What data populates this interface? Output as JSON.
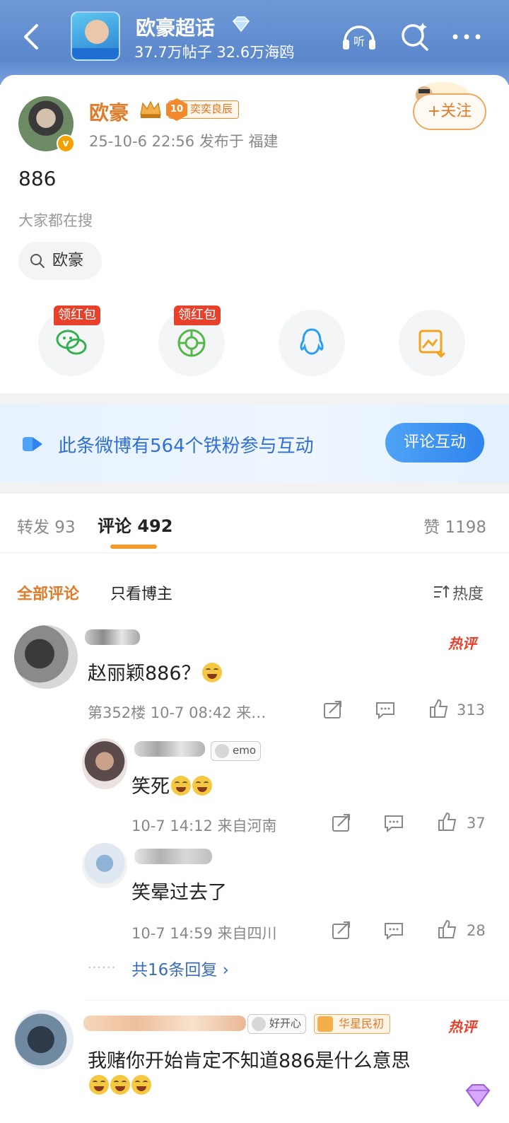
{
  "header": {
    "title": "欧豪超话",
    "subtitle": "37.7万帖子 32.6万海鸥"
  },
  "post": {
    "author": "欧豪",
    "fan_badge_level": "10",
    "fan_badge_label": "奕奕良辰",
    "meta": "25-10-6 22:56  发布于 福建",
    "follow_label": "+关注",
    "text": "886",
    "search_hint": "大家都在搜",
    "search_chip": "欧豪"
  },
  "share": {
    "items": [
      {
        "icon": "wechat-icon",
        "badge": "领红包"
      },
      {
        "icon": "moments-icon",
        "badge": "领红包"
      },
      {
        "icon": "qq-icon",
        "badge": ""
      },
      {
        "icon": "save-image-icon",
        "badge": ""
      }
    ]
  },
  "banner": {
    "text": "此条微博有564个铁粉参与互动",
    "button": "评论互动"
  },
  "tabs": {
    "repost": "转发 93",
    "comment": "评论 492",
    "like": "赞 1198"
  },
  "filter": {
    "all": "全部评论",
    "author_only": "只看博主",
    "sort": "热度"
  },
  "comments": [
    {
      "hot": "热评",
      "text": "赵丽颖886？",
      "meta": "第352楼  10-7 08:42  来…",
      "likes": "313",
      "replies": [
        {
          "badge": "emo",
          "text": "笑死",
          "meta": "10-7 14:12  来自河南",
          "likes": "37"
        },
        {
          "badge": "",
          "text": "笑晕过去了",
          "meta": "10-7 14:59  来自四川",
          "likes": "28"
        }
      ],
      "more_replies": "共16条回复 ›"
    },
    {
      "hot": "热评",
      "badge": "好开心",
      "fan_badge": "华星民初",
      "text": "我赌你开始肯定不知道886是什么意思"
    }
  ],
  "colors": {
    "header_bg": "#6f98d6",
    "accent_orange": "#e07b2a",
    "link_blue": "#2f6fd6",
    "hot_red": "#e8412b"
  }
}
